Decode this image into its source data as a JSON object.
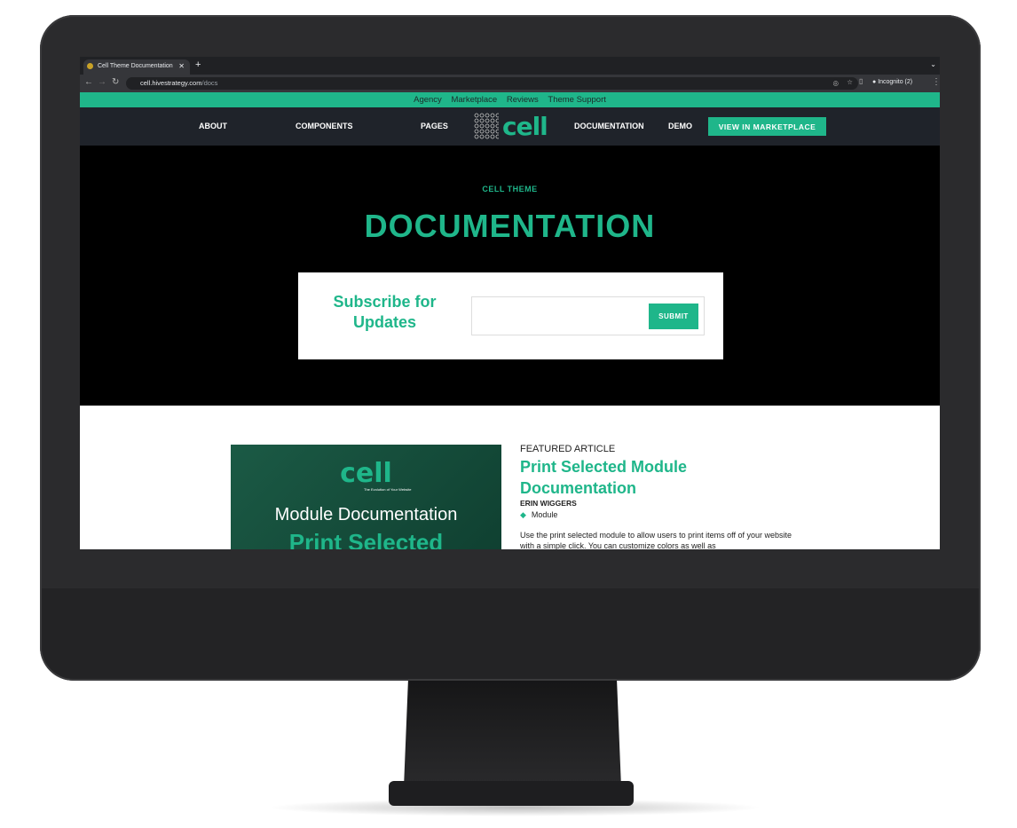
{
  "browser": {
    "tab_title": "Cell Theme Documentation",
    "url_host": "cell.hivestrategy.com",
    "url_path": "/docs",
    "profile": "Incognito (2)"
  },
  "topbar": {
    "links": [
      "Agency",
      "Marketplace",
      "Reviews",
      "Theme Support"
    ]
  },
  "nav": {
    "items": [
      "ABOUT",
      "COMPONENTS",
      "PAGES",
      "DOCUMENTATION",
      "DEMO"
    ],
    "logo": "cell",
    "cta": "VIEW IN MARKETPLACE"
  },
  "hero": {
    "eyebrow": "CELL THEME",
    "title": "DOCUMENTATION",
    "subscribe_title": "Subscribe for Updates",
    "email_value": "",
    "submit": "SUBMIT"
  },
  "featured": {
    "kicker": "FEATURED ARTICLE",
    "title": "Print Selected Module Documentation",
    "author": "ERIN WIGGERS",
    "tag": "Module",
    "excerpt": "Use the print selected module to allow users to print items off of your website with a simple click. You can customize colors as well as",
    "image": {
      "logo": "cell",
      "tagline": "The Evolution of Your Website",
      "line1": "Module Documentation",
      "line2": "Print Selected"
    }
  },
  "colors": {
    "accent": "#1fb68a",
    "nav_bg": "#1f232a",
    "hero_bg": "#000000"
  }
}
